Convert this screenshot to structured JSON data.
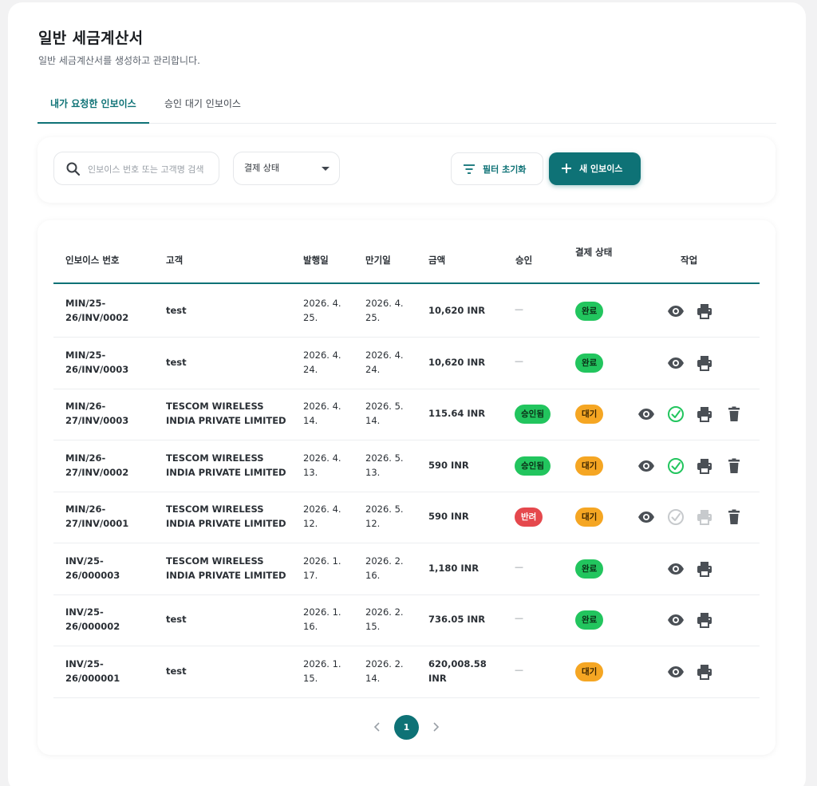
{
  "header": {
    "title": "일반 세금계산서",
    "subtitle": "일반 세금계산서를 생성하고 관리합니다."
  },
  "tabs": [
    {
      "label": "내가 요청한 인보이스",
      "active": true
    },
    {
      "label": "승인 대기 인보이스",
      "active": false
    }
  ],
  "filters": {
    "search_placeholder": "인보이스 번호 또는 고객명 검색",
    "search_value": "",
    "status_select": "결제 상태",
    "reset_label": "필터 초기화",
    "new_label": "새 인보이스"
  },
  "table": {
    "columns": [
      "인보이스 번호",
      "고객",
      "발행일",
      "만기일",
      "금액",
      "승인",
      "결제 상태",
      "작업"
    ],
    "rows": [
      {
        "no1": "MIN/25-",
        "no2": "26/INV/0002",
        "c1": "test",
        "c2": "",
        "i1": "2026. 4.",
        "i2": "25.",
        "d1": "2026. 4.",
        "d2": "25.",
        "a1": "10,620 INR",
        "a2": "",
        "approval": "—",
        "status": "완료"
      },
      {
        "no1": "MIN/25-",
        "no2": "26/INV/0003",
        "c1": "test",
        "c2": "",
        "i1": "2026. 4.",
        "i2": "24.",
        "d1": "2026. 4.",
        "d2": "24.",
        "a1": "10,620 INR",
        "a2": "",
        "approval": "—",
        "status": "완료"
      },
      {
        "no1": "MIN/26-",
        "no2": "27/INV/0003",
        "c1": "TESCOM WIRELESS",
        "c2": "INDIA PRIVATE LIMITED",
        "i1": "2026. 4.",
        "i2": "14.",
        "d1": "2026. 5.",
        "d2": "14.",
        "a1": "115.64 INR",
        "a2": "",
        "approval": "승인됨",
        "status": "대기"
      },
      {
        "no1": "MIN/26-",
        "no2": "27/INV/0002",
        "c1": "TESCOM WIRELESS",
        "c2": "INDIA PRIVATE LIMITED",
        "i1": "2026. 4.",
        "i2": "13.",
        "d1": "2026. 5.",
        "d2": "13.",
        "a1": "590 INR",
        "a2": "",
        "approval": "승인됨",
        "status": "대기"
      },
      {
        "no1": "MIN/26-",
        "no2": "27/INV/0001",
        "c1": "TESCOM WIRELESS",
        "c2": "INDIA PRIVATE LIMITED",
        "i1": "2026. 4.",
        "i2": "12.",
        "d1": "2026. 5.",
        "d2": "12.",
        "a1": "590 INR",
        "a2": "",
        "approval": "반려",
        "status": "대기"
      },
      {
        "no1": "INV/25-",
        "no2": "26/000003",
        "c1": "TESCOM WIRELESS",
        "c2": "INDIA PRIVATE LIMITED",
        "i1": "2026. 1.",
        "i2": "17.",
        "d1": "2026. 2.",
        "d2": "16.",
        "a1": "1,180 INR",
        "a2": "",
        "approval": "—",
        "status": "완료"
      },
      {
        "no1": "INV/25-",
        "no2": "26/000002",
        "c1": "test",
        "c2": "",
        "i1": "2026. 1.",
        "i2": "16.",
        "d1": "2026. 2.",
        "d2": "15.",
        "a1": "736.05 INR",
        "a2": "",
        "approval": "—",
        "status": "완료"
      },
      {
        "no1": "INV/25-",
        "no2": "26/000001",
        "c1": "test",
        "c2": "",
        "i1": "2026. 1.",
        "i2": "15.",
        "d1": "2026. 2.",
        "d2": "14.",
        "a1": "620,008.58",
        "a2": "INR",
        "approval": "—",
        "status": "대기"
      }
    ]
  },
  "pagination": {
    "current": "1",
    "prev": "‹",
    "next": "›"
  },
  "colors": {
    "accent": "#0e7276",
    "green": "#22c55e",
    "orange": "#f5a623",
    "red": "#e5484d"
  }
}
